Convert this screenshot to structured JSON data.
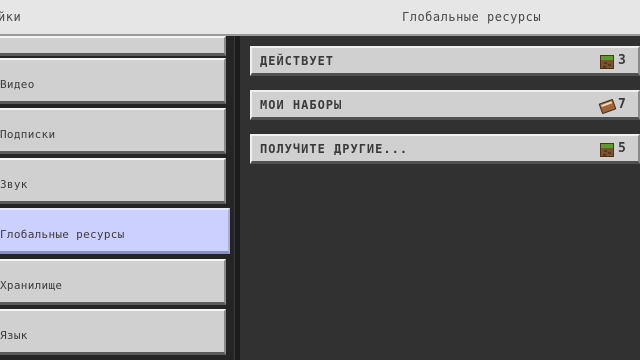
{
  "header": {
    "left_title": "йки",
    "center_title": "Глобальные ресурсы"
  },
  "sidebar": {
    "items": [
      {
        "label": ""
      },
      {
        "label": "Видео"
      },
      {
        "label": "Подписки"
      },
      {
        "label": "Звук"
      },
      {
        "label": "Глобальные ресурсы",
        "active": true
      },
      {
        "label": "Хранилище"
      },
      {
        "label": "Язык"
      }
    ]
  },
  "packs": {
    "rows": [
      {
        "label": "ДЕЙСТВУЕТ",
        "count": "3",
        "icon": "grass-block-icon"
      },
      {
        "label": "МОИ НАБОРЫ",
        "count": "7",
        "icon": "book-icon"
      },
      {
        "label": "ПОЛУЧИТЕ ДРУГИЕ...",
        "count": "5",
        "icon": "grass-block-icon"
      }
    ]
  },
  "colors": {
    "background": "#313131",
    "button": "#d0d0d0",
    "active_button": "#ccd0ff",
    "header": "#e6e6e6"
  }
}
